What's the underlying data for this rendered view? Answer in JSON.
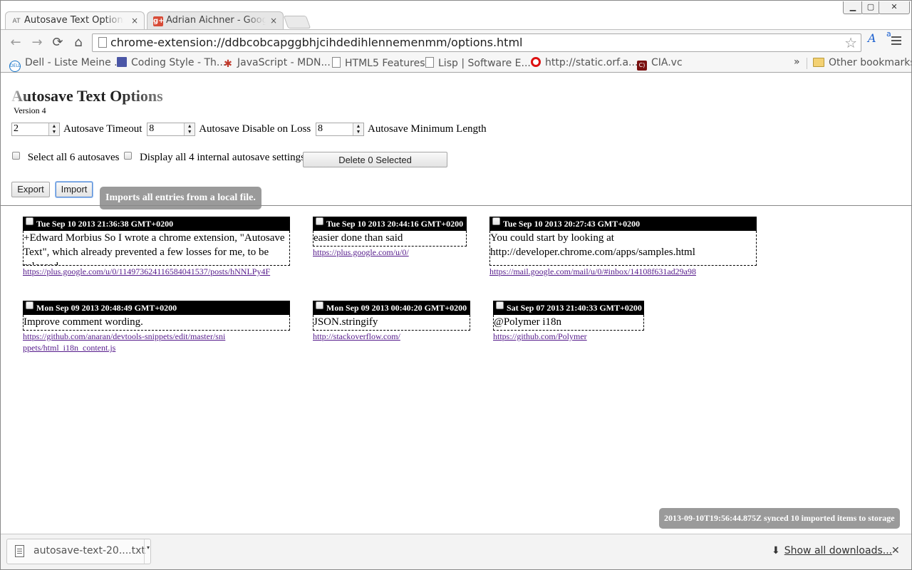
{
  "browser": {
    "tabs": [
      {
        "favicon": "AT",
        "title": "Autosave Text Options",
        "close": "×"
      },
      {
        "favicon": "g+",
        "title": "Adrian Aichner - Google+",
        "close": "×"
      }
    ],
    "window_controls": {
      "minimize": "▁",
      "maximize": "▢",
      "close": "✕"
    },
    "nav": {
      "back": "←",
      "forward": "→",
      "reload": "⟳",
      "home": "⌂"
    },
    "url": "chrome-extension://ddbcobcapggbhjcihdedihlennemenmm/options.html",
    "star": "☆",
    "ext_icon": "A",
    "ext_badge": "a"
  },
  "bookmarks": {
    "items": [
      {
        "label": "Dell - Liste Meine ...",
        "icon": "dell-icon",
        "glyph": "DELL"
      },
      {
        "label": "Coding Style - Th...",
        "icon": "coding-style-icon",
        "glyph": ""
      },
      {
        "label": "JavaScript - MDN...",
        "icon": "mdn-icon",
        "glyph": "✱"
      },
      {
        "label": "HTML5 Features",
        "icon": "page-icon",
        "glyph": ""
      },
      {
        "label": "Lisp | Software E...",
        "icon": "page-icon",
        "glyph": ""
      },
      {
        "label": "http://static.orf.a...",
        "icon": "orf-icon",
        "glyph": ""
      },
      {
        "label": "CIA.vc",
        "icon": "cia-icon",
        "glyph": "C)"
      }
    ],
    "overflow": "»",
    "other": "Other bookmarks"
  },
  "page": {
    "title": "Autosave Text Options",
    "version": "Version 4",
    "settings": [
      {
        "value": "2",
        "label": "Autosave Timeout"
      },
      {
        "value": "8",
        "label": "Autosave Disable on Loss"
      },
      {
        "value": "8",
        "label": "Autosave Minimum Length"
      }
    ],
    "select_all_label": "Select all 6 autosaves",
    "display_internal_label": "Display all 4 internal autosave settings",
    "delete_button": "Delete 0 Selected",
    "export_button": "Export",
    "import_button": "Import",
    "tooltip": "Imports all entries from a local file.",
    "toast": "2013-09-10T19:56:44.875Z synced 10 imported items to storage"
  },
  "entries": [
    {
      "date": "Tue Sep 10 2013 21:36:38 GMT+0200",
      "text": "+Edward Morbius So I wrote a chrome extension, \"Autosave Text\", which already prevented a few losses for me, to be released.",
      "link": "https://plus.google.com/u/0/114973624116584041537/posts/hNNLPy4F"
    },
    {
      "date": "Tue Sep 10 2013 20:44:16 GMT+0200",
      "text": "easier done than said",
      "link": "https://plus.google.com/u/0/"
    },
    {
      "date": "Tue Sep 10 2013 20:27:43 GMT+0200",
      "text": "You could start by looking at http://developer.chrome.com/apps/samples.html",
      "link": "https://mail.google.com/mail/u/0/#inbox/14108f631ad29a98"
    },
    {
      "date": "Mon Sep 09 2013 20:48:49 GMT+0200",
      "text": "Improve comment wording.",
      "link": "https://github.com/anaran/devtools-snippets/edit/master/snippets/html_i18n_content.js"
    },
    {
      "date": "Mon Sep 09 2013 00:40:20 GMT+0200",
      "text": "JSON.stringify",
      "link": "http://stackoverflow.com/"
    },
    {
      "date": "Sat Sep 07 2013 21:40:33 GMT+0200",
      "text": "@Polymer i18n",
      "link": "https://github.com/Polymer"
    }
  ],
  "downloads": {
    "file": "autosave-text-20....txt",
    "caret": "▾",
    "show_all": "Show all downloads...",
    "download_glyph": "⬇",
    "close": "✕"
  }
}
